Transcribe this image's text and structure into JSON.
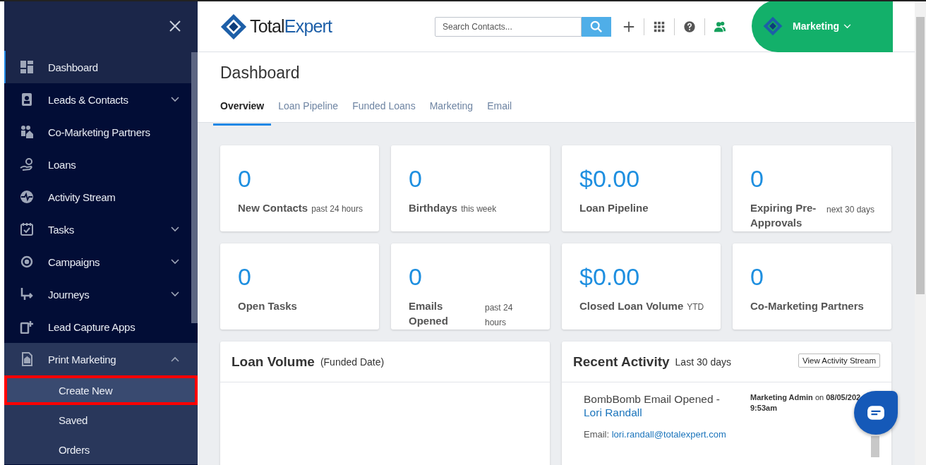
{
  "sidebar": {
    "items": [
      {
        "label": "Dashboard",
        "selected": true
      },
      {
        "label": "Leads & Contacts",
        "selected": false,
        "expanded": false
      },
      {
        "label": "Co-Marketing Partners",
        "selected": false
      },
      {
        "label": "Loans",
        "selected": false
      },
      {
        "label": "Activity Stream",
        "selected": false
      },
      {
        "label": "Tasks",
        "selected": false,
        "expanded": false
      },
      {
        "label": "Campaigns",
        "selected": false,
        "expanded": false
      },
      {
        "label": "Journeys",
        "selected": false,
        "expanded": false
      },
      {
        "label": "Lead Capture Apps",
        "selected": false
      },
      {
        "label": "Print Marketing",
        "selected": false,
        "expanded": true,
        "children": [
          {
            "label": "Create New",
            "selected": true,
            "highlighted": true
          },
          {
            "label": "Saved",
            "selected": false,
            "highlighted": false
          },
          {
            "label": "Orders",
            "selected": false,
            "highlighted": false
          }
        ]
      }
    ]
  },
  "topbar": {
    "logo": {
      "part_1": "Total",
      "part_2": "Expert"
    },
    "search": {
      "placeholder": "Search Contacts..."
    },
    "account": {
      "label": "Marketing"
    }
  },
  "page": {
    "title": "Dashboard",
    "tabs": [
      {
        "label": "Overview",
        "selected": true
      },
      {
        "label": "Loan Pipeline",
        "selected": false
      },
      {
        "label": "Funded Loans",
        "selected": false
      },
      {
        "label": "Marketing",
        "selected": false
      },
      {
        "label": "Email",
        "selected": false
      }
    ]
  },
  "cards": [
    {
      "value": "0",
      "label": "New Contacts",
      "note": "past 24 hours",
      "kind": "inline"
    },
    {
      "value": "0",
      "label": "Birthdays",
      "note": "this week",
      "kind": "inline"
    },
    {
      "value": "$0.00",
      "label": "Loan Pipeline",
      "kind": "inline"
    },
    {
      "value": "0",
      "label": "Expiring Pre-Approvals",
      "note": "next 30 days",
      "kind": "column"
    },
    {
      "value": "0",
      "label": "Open Tasks",
      "kind": "inline"
    },
    {
      "value": "0",
      "label": "Emails Opened",
      "note": "past 24 hours",
      "kind": "column"
    },
    {
      "value": "$0.00",
      "label": "Closed Loan Volume",
      "note": "YTD",
      "kind": "inline"
    },
    {
      "value": "0",
      "label": "Co-Marketing Partners",
      "kind": "inline"
    }
  ],
  "loan_volume": {
    "title": "Loan Volume",
    "subtitle": "(Funded Date)"
  },
  "recent_activity": {
    "title": "Recent Activity",
    "subtitle": "Last 30 days",
    "button": "View Activity Stream",
    "entries": [
      {
        "event": "BombBomb Email Opened - ",
        "contact": "Lori Randall",
        "user": "Marketing Admin",
        "on": "on",
        "date": "08/05/202",
        "time": "9:53am",
        "email_label": "Email:",
        "email": "lori.randall@totalexpert.com"
      }
    ]
  }
}
